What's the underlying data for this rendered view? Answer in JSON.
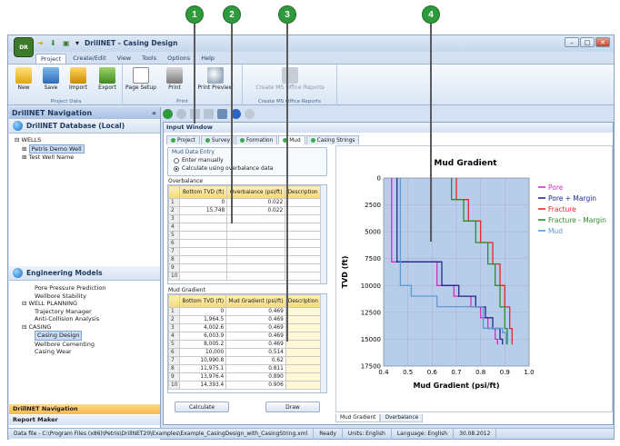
{
  "app": {
    "title": "DrillNET - Casing Design",
    "orb_label": "DR"
  },
  "menu": [
    "Project",
    "Create/Edit",
    "View",
    "Tools",
    "Options",
    "Help"
  ],
  "ribbon": {
    "groups": [
      {
        "label": "Project Data",
        "buttons": [
          "New",
          "Save",
          "Import",
          "Export"
        ]
      },
      {
        "label": "Print",
        "buttons": [
          "Page Setup",
          "Print",
          "Print Preview"
        ]
      },
      {
        "label": "Create MS Office Reports",
        "buttons": [
          "Create MS Office Reports"
        ]
      }
    ]
  },
  "nav": {
    "title": "DrillNET Navigation",
    "collapse_glyph": "«",
    "database": "DrillNET Database (Local)",
    "wells_tree": [
      "WELLS",
      "Petris Demo Well",
      "Test Well Name"
    ],
    "engineering": "Engineering Models",
    "models": [
      {
        "label": "Pore Pressure Prediction",
        "level": 2
      },
      {
        "label": "Wellbore Stability",
        "level": 2
      },
      {
        "label": "WELL PLANNING",
        "level": 1
      },
      {
        "label": "Trajectory Manager",
        "level": 2
      },
      {
        "label": "Anti-Collision Analysis",
        "level": 2
      },
      {
        "label": "CASING",
        "level": 1
      },
      {
        "label": "Casing Design",
        "level": 2,
        "selected": true
      },
      {
        "label": "Wellbore Cementing",
        "level": 2
      },
      {
        "label": "Casing Wear",
        "level": 2
      }
    ],
    "bottom_items": [
      "DrillNET Navigation",
      "Report Maker"
    ]
  },
  "input_window": {
    "title": "Input Window",
    "tabs": [
      "Project",
      "Survey",
      "Formation",
      "Mud",
      "Casing Strings"
    ],
    "active_tab": "Mud",
    "mud_data_entry": {
      "legend": "Mud Data Entry",
      "options": [
        "Enter manually",
        "Calculate using overbalance data"
      ],
      "selected": 1
    },
    "overbalance": {
      "label": "Overbalance",
      "headers": [
        "Bottom TVD (ft)",
        "Overbalance (psi/ft)",
        "Description"
      ],
      "rows": [
        [
          "1",
          "0",
          "0.022",
          ""
        ],
        [
          "2",
          "15,748",
          "0.022",
          ""
        ],
        [
          "3",
          "",
          "",
          ""
        ],
        [
          "4",
          "",
          "",
          ""
        ],
        [
          "5",
          "",
          "",
          ""
        ],
        [
          "6",
          "",
          "",
          ""
        ],
        [
          "7",
          "",
          "",
          ""
        ],
        [
          "8",
          "",
          "",
          ""
        ],
        [
          "9",
          "",
          "",
          ""
        ],
        [
          "10",
          "",
          "",
          ""
        ]
      ]
    },
    "mud_gradient": {
      "label": "Mud Gradient",
      "headers": [
        "Bottom TVD (ft)",
        "Mud Gradient (psi/ft)",
        "Description"
      ],
      "rows": [
        [
          "1",
          "0",
          "0.469",
          ""
        ],
        [
          "2",
          "1,964.5",
          "0.469",
          ""
        ],
        [
          "3",
          "4,002.6",
          "0.469",
          ""
        ],
        [
          "4",
          "6,003.9",
          "0.469",
          ""
        ],
        [
          "5",
          "8,005.2",
          "0.469",
          ""
        ],
        [
          "6",
          "10,000",
          "0.514",
          ""
        ],
        [
          "7",
          "10,990.8",
          "0.62",
          ""
        ],
        [
          "8",
          "11,975.1",
          "0.811",
          ""
        ],
        [
          "9",
          "13,976.4",
          "0.890",
          ""
        ],
        [
          "10",
          "14,393.4",
          "0.906",
          ""
        ]
      ]
    },
    "buttons": {
      "calculate": "Calculate",
      "draw": "Draw"
    },
    "chart_tabs": [
      "Mud Gradient",
      "Overbalance"
    ]
  },
  "callouts": [
    "1",
    "2",
    "3",
    "4"
  ],
  "chart_data": {
    "type": "line",
    "title": "Mud Gradient",
    "xlabel": "Mud Gradient (psi/ft)",
    "ylabel": "TVD (ft)",
    "xlim": [
      0.4,
      1.0
    ],
    "ylim": [
      0,
      17500
    ],
    "y_inverted": true,
    "xticks": [
      "0.4",
      "0.5",
      "0.6",
      "0.7",
      "0.8",
      "0.9",
      "1.0"
    ],
    "yticks": [
      "0",
      "2500",
      "5000",
      "7500",
      "10000",
      "12500",
      "15000",
      "17500"
    ],
    "legend_position": "right",
    "series": [
      {
        "name": "Pore",
        "color": "#d42fbf",
        "x": [
          0.433,
          0.433,
          0.62,
          0.62,
          0.69,
          0.69,
          0.76,
          0.76,
          0.8,
          0.8,
          0.83,
          0.83,
          0.86,
          0.86,
          0.87,
          0.87
        ],
        "y": [
          0,
          7800,
          7800,
          10000,
          10000,
          11000,
          11000,
          12000,
          12000,
          13000,
          13000,
          14000,
          14000,
          15000,
          15000,
          15500
        ]
      },
      {
        "name": "Pore + Margin",
        "color": "#1f2a8a",
        "x": [
          0.455,
          0.455,
          0.64,
          0.64,
          0.71,
          0.71,
          0.78,
          0.78,
          0.82,
          0.82,
          0.85,
          0.85,
          0.88,
          0.88,
          0.89,
          0.89
        ],
        "y": [
          0,
          7800,
          7800,
          10000,
          10000,
          11000,
          11000,
          12000,
          12000,
          13000,
          13000,
          14000,
          14000,
          15000,
          15000,
          15500
        ]
      },
      {
        "name": "Fracture",
        "color": "#e8262a",
        "x": [
          0.7,
          0.7,
          0.75,
          0.75,
          0.8,
          0.8,
          0.85,
          0.85,
          0.88,
          0.88,
          0.9,
          0.9,
          0.92,
          0.92,
          0.93,
          0.93
        ],
        "y": [
          0,
          2000,
          2000,
          4000,
          4000,
          6000,
          6000,
          8000,
          8000,
          10000,
          10000,
          12000,
          12000,
          14000,
          14000,
          15500
        ]
      },
      {
        "name": "Fracture - Margin",
        "color": "#2e8b2e",
        "x": [
          0.68,
          0.68,
          0.73,
          0.73,
          0.78,
          0.78,
          0.83,
          0.83,
          0.86,
          0.86,
          0.88,
          0.88,
          0.9,
          0.9,
          0.91,
          0.91
        ],
        "y": [
          0,
          2000,
          2000,
          4000,
          4000,
          6000,
          6000,
          8000,
          8000,
          10000,
          10000,
          12000,
          12000,
          14000,
          14000,
          15500
        ]
      },
      {
        "name": "Mud",
        "color": "#5b9bd5",
        "x": [
          0.469,
          0.469,
          0.514,
          0.514,
          0.62,
          0.62,
          0.811,
          0.811,
          0.89,
          0.89,
          0.906,
          0.906
        ],
        "y": [
          0,
          10000,
          10000,
          10991,
          10991,
          11975,
          11975,
          13976,
          13976,
          14393,
          14393,
          15500
        ]
      }
    ]
  },
  "status": [
    "Data file - C:\\Program Files (x86)\\Petris\\DrillNET20\\Examples\\Example_CasingDesign_with_CasingString.xml",
    "Ready",
    "Units: English",
    "Language: English",
    "30.08.2012"
  ]
}
